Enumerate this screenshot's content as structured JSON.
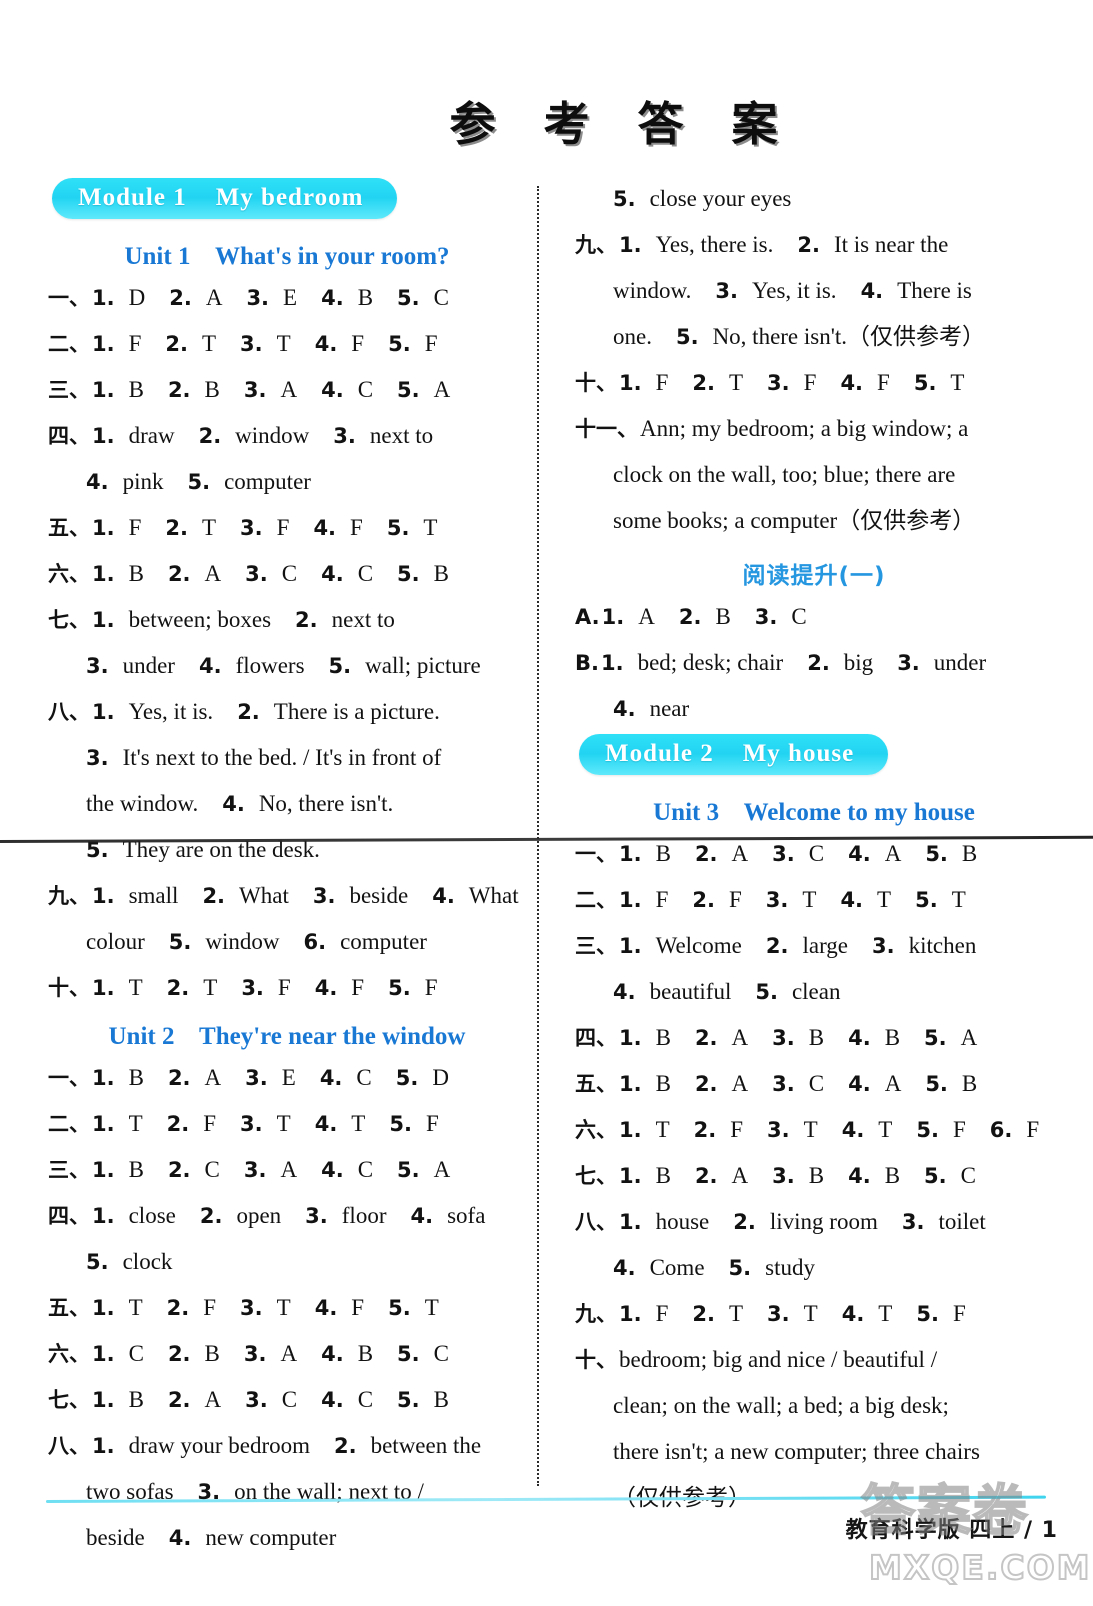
{
  "page_title": "参 考 答 案",
  "footer": "教育科学版 四上 / 1",
  "watermark": {
    "cn": "答案卷",
    "en": "MXQE.COM"
  },
  "colors": {
    "banner_cyan": "#22d4f2",
    "unit_blue": "#1878d4",
    "cn_heading_blue": "#2596e0",
    "rule_cyan": "#6fdff2",
    "text_black": "#121212"
  },
  "left_column": {
    "module_banner": "Module 1    My bedroom",
    "sections": [
      {
        "type": "unit_heading",
        "text": "Unit 1    What's in your room?"
      },
      {
        "type": "row",
        "label": "一、",
        "items": [
          {
            "n": "1.",
            "t": "D"
          },
          {
            "n": "2.",
            "t": "A"
          },
          {
            "n": "3.",
            "t": "E"
          },
          {
            "n": "4.",
            "t": "B"
          },
          {
            "n": "5.",
            "t": "C"
          }
        ]
      },
      {
        "type": "row",
        "label": "二、",
        "items": [
          {
            "n": "1.",
            "t": "F"
          },
          {
            "n": "2.",
            "t": "T"
          },
          {
            "n": "3.",
            "t": "T"
          },
          {
            "n": "4.",
            "t": "F"
          },
          {
            "n": "5.",
            "t": "F"
          }
        ]
      },
      {
        "type": "row",
        "label": "三、",
        "items": [
          {
            "n": "1.",
            "t": "B"
          },
          {
            "n": "2.",
            "t": "B"
          },
          {
            "n": "3.",
            "t": "A"
          },
          {
            "n": "4.",
            "t": "C"
          },
          {
            "n": "5.",
            "t": "A"
          }
        ]
      },
      {
        "type": "row",
        "label": "四、",
        "items": [
          {
            "n": "1.",
            "t": "draw"
          },
          {
            "n": "2.",
            "t": "window"
          },
          {
            "n": "3.",
            "t": "next to"
          }
        ]
      },
      {
        "type": "cont",
        "items": [
          {
            "n": "4.",
            "t": "pink"
          },
          {
            "n": "5.",
            "t": "computer"
          }
        ]
      },
      {
        "type": "row",
        "label": "五、",
        "items": [
          {
            "n": "1.",
            "t": "F"
          },
          {
            "n": "2.",
            "t": "T"
          },
          {
            "n": "3.",
            "t": "F"
          },
          {
            "n": "4.",
            "t": "F"
          },
          {
            "n": "5.",
            "t": "T"
          }
        ]
      },
      {
        "type": "row",
        "label": "六、",
        "items": [
          {
            "n": "1.",
            "t": "B"
          },
          {
            "n": "2.",
            "t": "A"
          },
          {
            "n": "3.",
            "t": "C"
          },
          {
            "n": "4.",
            "t": "C"
          },
          {
            "n": "5.",
            "t": "B"
          }
        ]
      },
      {
        "type": "row",
        "label": "七、",
        "items": [
          {
            "n": "1.",
            "t": "between; boxes"
          },
          {
            "n": "2.",
            "t": "next to"
          }
        ]
      },
      {
        "type": "cont",
        "items": [
          {
            "n": "3.",
            "t": "under"
          },
          {
            "n": "4.",
            "t": "flowers"
          },
          {
            "n": "5.",
            "t": "wall; picture"
          }
        ]
      },
      {
        "type": "row",
        "label": "八、",
        "items": [
          {
            "n": "1.",
            "t": "Yes, it is."
          },
          {
            "n": "2.",
            "t": "There is a picture."
          }
        ]
      },
      {
        "type": "cont",
        "items": [
          {
            "n": "3.",
            "t": "It's next to the bed. / It's in front of"
          }
        ]
      },
      {
        "type": "cont_plain",
        "items": [
          {
            "n": "",
            "t": "the window."
          },
          {
            "n": "4.",
            "t": "No, there isn't."
          }
        ]
      },
      {
        "type": "cont",
        "items": [
          {
            "n": "5.",
            "t": "They are on the desk."
          }
        ]
      },
      {
        "type": "row",
        "label": "九、",
        "items": [
          {
            "n": "1.",
            "t": "small"
          },
          {
            "n": "2.",
            "t": "What"
          },
          {
            "n": "3.",
            "t": "beside"
          },
          {
            "n": "4.",
            "t": "What"
          }
        ]
      },
      {
        "type": "cont_plain",
        "items": [
          {
            "n": "",
            "t": "colour"
          },
          {
            "n": "5.",
            "t": "window"
          },
          {
            "n": "6.",
            "t": "computer"
          }
        ]
      },
      {
        "type": "row",
        "label": "十、",
        "items": [
          {
            "n": "1.",
            "t": "T"
          },
          {
            "n": "2.",
            "t": "T"
          },
          {
            "n": "3.",
            "t": "F"
          },
          {
            "n": "4.",
            "t": "F"
          },
          {
            "n": "5.",
            "t": "F"
          }
        ]
      },
      {
        "type": "unit_heading",
        "text": "Unit 2    They're near the window"
      },
      {
        "type": "row",
        "label": "一、",
        "items": [
          {
            "n": "1.",
            "t": "B"
          },
          {
            "n": "2.",
            "t": "A"
          },
          {
            "n": "3.",
            "t": "E"
          },
          {
            "n": "4.",
            "t": "C"
          },
          {
            "n": "5.",
            "t": "D"
          }
        ]
      },
      {
        "type": "row",
        "label": "二、",
        "items": [
          {
            "n": "1.",
            "t": "T"
          },
          {
            "n": "2.",
            "t": "F"
          },
          {
            "n": "3.",
            "t": "T"
          },
          {
            "n": "4.",
            "t": "T"
          },
          {
            "n": "5.",
            "t": "F"
          }
        ]
      },
      {
        "type": "row",
        "label": "三、",
        "items": [
          {
            "n": "1.",
            "t": "B"
          },
          {
            "n": "2.",
            "t": "C"
          },
          {
            "n": "3.",
            "t": "A"
          },
          {
            "n": "4.",
            "t": "C"
          },
          {
            "n": "5.",
            "t": "A"
          }
        ]
      },
      {
        "type": "row",
        "label": "四、",
        "items": [
          {
            "n": "1.",
            "t": "close"
          },
          {
            "n": "2.",
            "t": "open"
          },
          {
            "n": "3.",
            "t": "floor"
          },
          {
            "n": "4.",
            "t": "sofa"
          }
        ]
      },
      {
        "type": "cont",
        "items": [
          {
            "n": "5.",
            "t": "clock"
          }
        ]
      },
      {
        "type": "row",
        "label": "五、",
        "items": [
          {
            "n": "1.",
            "t": "T"
          },
          {
            "n": "2.",
            "t": "F"
          },
          {
            "n": "3.",
            "t": "T"
          },
          {
            "n": "4.",
            "t": "F"
          },
          {
            "n": "5.",
            "t": "T"
          }
        ]
      },
      {
        "type": "row",
        "label": "六、",
        "items": [
          {
            "n": "1.",
            "t": "C"
          },
          {
            "n": "2.",
            "t": "B"
          },
          {
            "n": "3.",
            "t": "A"
          },
          {
            "n": "4.",
            "t": "B"
          },
          {
            "n": "5.",
            "t": "C"
          }
        ]
      },
      {
        "type": "row",
        "label": "七、",
        "items": [
          {
            "n": "1.",
            "t": "B"
          },
          {
            "n": "2.",
            "t": "A"
          },
          {
            "n": "3.",
            "t": "C"
          },
          {
            "n": "4.",
            "t": "C"
          },
          {
            "n": "5.",
            "t": "B"
          }
        ]
      },
      {
        "type": "row",
        "label": "八、",
        "items": [
          {
            "n": "1.",
            "t": "draw your bedroom"
          },
          {
            "n": "2.",
            "t": "between the"
          }
        ]
      },
      {
        "type": "cont_plain",
        "items": [
          {
            "n": "",
            "t": "two sofas"
          },
          {
            "n": "3.",
            "t": "on the wall; next to /"
          }
        ]
      },
      {
        "type": "cont_plain",
        "items": [
          {
            "n": "",
            "t": "beside"
          },
          {
            "n": "4.",
            "t": "new computer"
          }
        ]
      }
    ]
  },
  "right_column": {
    "module_banner": "Module 2    My house",
    "sections": [
      {
        "type": "cont",
        "items": [
          {
            "n": "5.",
            "t": "close your eyes"
          }
        ]
      },
      {
        "type": "row",
        "label": "九、",
        "items": [
          {
            "n": "1.",
            "t": "Yes, there is."
          },
          {
            "n": "2.",
            "t": "It is near the"
          }
        ]
      },
      {
        "type": "cont_plain",
        "items": [
          {
            "n": "",
            "t": "window."
          },
          {
            "n": "3.",
            "t": "Yes, it is."
          },
          {
            "n": "4.",
            "t": "There is"
          }
        ]
      },
      {
        "type": "cont_plain",
        "items": [
          {
            "n": "",
            "t": "one."
          },
          {
            "n": "5.",
            "t": "No, there isn't.（仅供参考）"
          }
        ]
      },
      {
        "type": "row",
        "label": "十、",
        "items": [
          {
            "n": "1.",
            "t": "F"
          },
          {
            "n": "2.",
            "t": "T"
          },
          {
            "n": "3.",
            "t": "F"
          },
          {
            "n": "4.",
            "t": "F"
          },
          {
            "n": "5.",
            "t": "T"
          }
        ]
      },
      {
        "type": "row",
        "label": "十一、",
        "items": [
          {
            "n": "",
            "t": "Ann; my bedroom; a big window; a"
          }
        ]
      },
      {
        "type": "cont_plain",
        "items": [
          {
            "n": "",
            "t": "clock on the wall, too; blue; there are"
          }
        ]
      },
      {
        "type": "cont_plain",
        "items": [
          {
            "n": "",
            "t": "some books; a computer（仅供参考）"
          }
        ]
      },
      {
        "type": "unit_heading_cn",
        "text": "阅读提升(一)"
      },
      {
        "type": "row",
        "label": "A.",
        "items": [
          {
            "n": "1.",
            "t": "A"
          },
          {
            "n": "2.",
            "t": "B"
          },
          {
            "n": "3.",
            "t": "C"
          }
        ]
      },
      {
        "type": "row",
        "label": "B.",
        "items": [
          {
            "n": "1.",
            "t": "bed; desk; chair"
          },
          {
            "n": "2.",
            "t": "big"
          },
          {
            "n": "3.",
            "t": "under"
          }
        ]
      },
      {
        "type": "cont",
        "items": [
          {
            "n": "4.",
            "t": "near"
          }
        ]
      },
      {
        "type": "module_banner_slot"
      },
      {
        "type": "unit_heading",
        "text": "Unit 3    Welcome to my house"
      },
      {
        "type": "row",
        "label": "一、",
        "items": [
          {
            "n": "1.",
            "t": "B"
          },
          {
            "n": "2.",
            "t": "A"
          },
          {
            "n": "3.",
            "t": "C"
          },
          {
            "n": "4.",
            "t": "A"
          },
          {
            "n": "5.",
            "t": "B"
          }
        ]
      },
      {
        "type": "row",
        "label": "二、",
        "items": [
          {
            "n": "1.",
            "t": "F"
          },
          {
            "n": "2.",
            "t": "F"
          },
          {
            "n": "3.",
            "t": "T"
          },
          {
            "n": "4.",
            "t": "T"
          },
          {
            "n": "5.",
            "t": "T"
          }
        ]
      },
      {
        "type": "row",
        "label": "三、",
        "items": [
          {
            "n": "1.",
            "t": "Welcome"
          },
          {
            "n": "2.",
            "t": "large"
          },
          {
            "n": "3.",
            "t": "kitchen"
          }
        ]
      },
      {
        "type": "cont",
        "items": [
          {
            "n": "4.",
            "t": "beautiful"
          },
          {
            "n": "5.",
            "t": "clean"
          }
        ]
      },
      {
        "type": "row",
        "label": "四、",
        "items": [
          {
            "n": "1.",
            "t": "B"
          },
          {
            "n": "2.",
            "t": "A"
          },
          {
            "n": "3.",
            "t": "B"
          },
          {
            "n": "4.",
            "t": "B"
          },
          {
            "n": "5.",
            "t": "A"
          }
        ]
      },
      {
        "type": "row",
        "label": "五、",
        "items": [
          {
            "n": "1.",
            "t": "B"
          },
          {
            "n": "2.",
            "t": "A"
          },
          {
            "n": "3.",
            "t": "C"
          },
          {
            "n": "4.",
            "t": "A"
          },
          {
            "n": "5.",
            "t": "B"
          }
        ]
      },
      {
        "type": "row",
        "label": "六、",
        "items": [
          {
            "n": "1.",
            "t": "T"
          },
          {
            "n": "2.",
            "t": "F"
          },
          {
            "n": "3.",
            "t": "T"
          },
          {
            "n": "4.",
            "t": "T"
          },
          {
            "n": "5.",
            "t": "F"
          },
          {
            "n": "6.",
            "t": "F"
          }
        ]
      },
      {
        "type": "row",
        "label": "七、",
        "items": [
          {
            "n": "1.",
            "t": "B"
          },
          {
            "n": "2.",
            "t": "A"
          },
          {
            "n": "3.",
            "t": "B"
          },
          {
            "n": "4.",
            "t": "B"
          },
          {
            "n": "5.",
            "t": "C"
          }
        ]
      },
      {
        "type": "row",
        "label": "八、",
        "items": [
          {
            "n": "1.",
            "t": "house"
          },
          {
            "n": "2.",
            "t": "living room"
          },
          {
            "n": "3.",
            "t": "toilet"
          }
        ]
      },
      {
        "type": "cont",
        "items": [
          {
            "n": "4.",
            "t": "Come"
          },
          {
            "n": "5.",
            "t": "study"
          }
        ]
      },
      {
        "type": "row",
        "label": "九、",
        "items": [
          {
            "n": "1.",
            "t": "F"
          },
          {
            "n": "2.",
            "t": "T"
          },
          {
            "n": "3.",
            "t": "T"
          },
          {
            "n": "4.",
            "t": "T"
          },
          {
            "n": "5.",
            "t": "F"
          }
        ]
      },
      {
        "type": "row",
        "label": "十、",
        "items": [
          {
            "n": "",
            "t": "bedroom; big and nice / beautiful /"
          }
        ]
      },
      {
        "type": "cont_plain",
        "items": [
          {
            "n": "",
            "t": "clean; on the wall; a bed; a big desk;"
          }
        ]
      },
      {
        "type": "cont_plain",
        "items": [
          {
            "n": "",
            "t": "there isn't; a new computer; three chairs"
          }
        ]
      },
      {
        "type": "cont_plain",
        "items": [
          {
            "n": "",
            "t": "（仅供参考）"
          }
        ]
      }
    ]
  }
}
